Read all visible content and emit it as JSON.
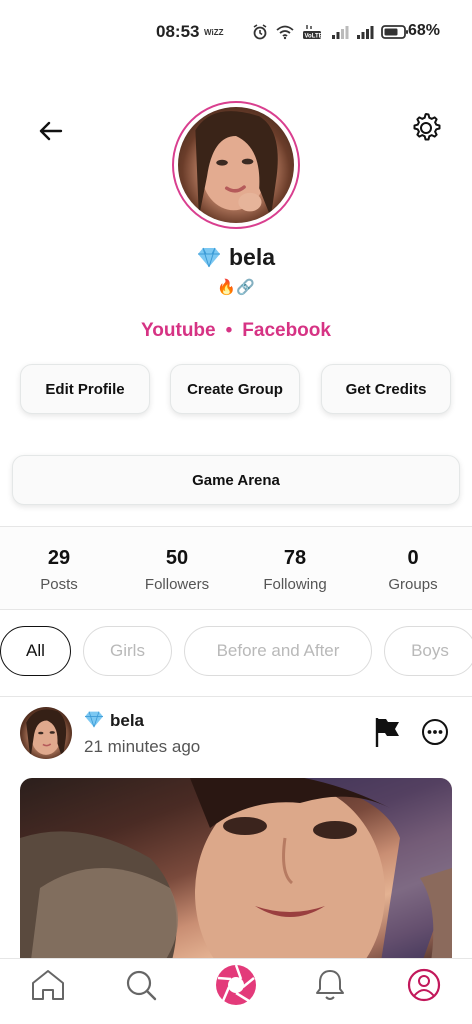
{
  "status_bar": {
    "time": "08:53",
    "network_tag": "WiZZ",
    "battery": "68%"
  },
  "profile": {
    "username": "bela",
    "badges": "🔥🔗",
    "links": [
      "Youtube",
      "Facebook"
    ],
    "link_separator": "•"
  },
  "actions": {
    "edit_profile": "Edit Profile",
    "create_group": "Create Group",
    "get_credits": "Get Credits",
    "game_arena": "Game Arena"
  },
  "stats": [
    {
      "value": "29",
      "label": "Posts"
    },
    {
      "value": "50",
      "label": "Followers"
    },
    {
      "value": "78",
      "label": "Following"
    },
    {
      "value": "0",
      "label": "Groups"
    }
  ],
  "filters": {
    "items": [
      "All",
      "Girls",
      "Before and After",
      "Boys"
    ],
    "selected": "All"
  },
  "post": {
    "author": "bela",
    "time": "21 minutes ago"
  },
  "colors": {
    "accent": "#d63384",
    "text": "#111111",
    "muted": "#555555"
  },
  "icons": {
    "back": "arrow-left-icon",
    "settings": "gear-icon",
    "verified": "diamond-icon",
    "flag": "flag-icon",
    "more": "more-icon",
    "nav": [
      "home-icon",
      "search-icon",
      "camera-aperture-icon",
      "bell-icon",
      "profile-icon"
    ]
  }
}
